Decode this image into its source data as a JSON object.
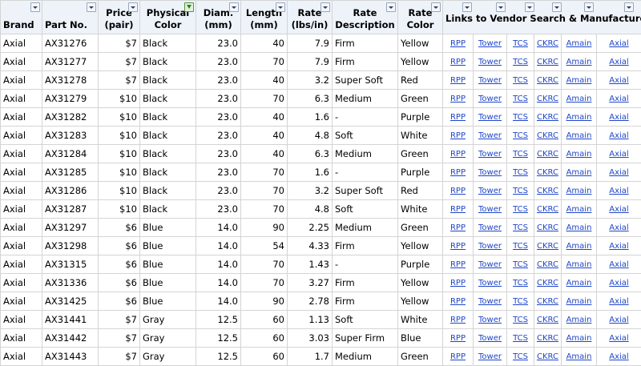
{
  "headers": {
    "brand": "Brand",
    "part": "Part No.",
    "price_line1": "Price",
    "price_line2": "(pair)",
    "color_line1": "Physical",
    "color_line2": "Color",
    "diam_line1": "Diam.",
    "diam_line2": "(mm)",
    "length_line1": "Length",
    "length_line2": "(mm)",
    "rate_line1": "Rate",
    "rate_line2": "(lbs/in)",
    "ratedesc_line1": "Rate",
    "ratedesc_line2": "Description",
    "ratecolor_line1": "Rate",
    "ratecolor_line2": "Color",
    "links": "Links to Vendor Search & Manufacturer"
  },
  "filters": {
    "active_icon": "filter-funnel-icon",
    "inactive_icon": "dropdown-arrow-icon"
  },
  "link_labels": [
    "RPP",
    "Tower",
    "TCS",
    "CKRC",
    "Amain",
    "Axial"
  ],
  "rows": [
    {
      "brand": "Axial",
      "part": "AX31276",
      "price": "$7",
      "color": "Black",
      "diam": "23.0",
      "length": "40",
      "rate": "7.9",
      "desc": "Firm",
      "rcolor": "Yellow"
    },
    {
      "brand": "Axial",
      "part": "AX31277",
      "price": "$7",
      "color": "Black",
      "diam": "23.0",
      "length": "70",
      "rate": "7.9",
      "desc": "Firm",
      "rcolor": "Yellow"
    },
    {
      "brand": "Axial",
      "part": "AX31278",
      "price": "$7",
      "color": "Black",
      "diam": "23.0",
      "length": "40",
      "rate": "3.2",
      "desc": "Super Soft",
      "rcolor": "Red"
    },
    {
      "brand": "Axial",
      "part": "AX31279",
      "price": "$10",
      "color": "Black",
      "diam": "23.0",
      "length": "70",
      "rate": "6.3",
      "desc": "Medium",
      "rcolor": "Green"
    },
    {
      "brand": "Axial",
      "part": "AX31282",
      "price": "$10",
      "color": "Black",
      "diam": "23.0",
      "length": "40",
      "rate": "1.6",
      "desc": "-",
      "rcolor": "Purple"
    },
    {
      "brand": "Axial",
      "part": "AX31283",
      "price": "$10",
      "color": "Black",
      "diam": "23.0",
      "length": "40",
      "rate": "4.8",
      "desc": "Soft",
      "rcolor": "White"
    },
    {
      "brand": "Axial",
      "part": "AX31284",
      "price": "$10",
      "color": "Black",
      "diam": "23.0",
      "length": "40",
      "rate": "6.3",
      "desc": "Medium",
      "rcolor": "Green"
    },
    {
      "brand": "Axial",
      "part": "AX31285",
      "price": "$10",
      "color": "Black",
      "diam": "23.0",
      "length": "70",
      "rate": "1.6",
      "desc": "-",
      "rcolor": "Purple"
    },
    {
      "brand": "Axial",
      "part": "AX31286",
      "price": "$10",
      "color": "Black",
      "diam": "23.0",
      "length": "70",
      "rate": "3.2",
      "desc": "Super Soft",
      "rcolor": "Red"
    },
    {
      "brand": "Axial",
      "part": "AX31287",
      "price": "$10",
      "color": "Black",
      "diam": "23.0",
      "length": "70",
      "rate": "4.8",
      "desc": "Soft",
      "rcolor": "White"
    },
    {
      "brand": "Axial",
      "part": "AX31297",
      "price": "$6",
      "color": "Blue",
      "diam": "14.0",
      "length": "90",
      "rate": "2.25",
      "desc": "Medium",
      "rcolor": "Green"
    },
    {
      "brand": "Axial",
      "part": "AX31298",
      "price": "$6",
      "color": "Blue",
      "diam": "14.0",
      "length": "54",
      "rate": "4.33",
      "desc": "Firm",
      "rcolor": "Yellow"
    },
    {
      "brand": "Axial",
      "part": "AX31315",
      "price": "$6",
      "color": "Blue",
      "diam": "14.0",
      "length": "70",
      "rate": "1.43",
      "desc": "-",
      "rcolor": "Purple"
    },
    {
      "brand": "Axial",
      "part": "AX31336",
      "price": "$6",
      "color": "Blue",
      "diam": "14.0",
      "length": "70",
      "rate": "3.27",
      "desc": "Firm",
      "rcolor": "Yellow"
    },
    {
      "brand": "Axial",
      "part": "AX31425",
      "price": "$6",
      "color": "Blue",
      "diam": "14.0",
      "length": "90",
      "rate": "2.78",
      "desc": "Firm",
      "rcolor": "Yellow"
    },
    {
      "brand": "Axial",
      "part": "AX31441",
      "price": "$7",
      "color": "Gray",
      "diam": "12.5",
      "length": "60",
      "rate": "1.13",
      "desc": "Soft",
      "rcolor": "White"
    },
    {
      "brand": "Axial",
      "part": "AX31442",
      "price": "$7",
      "color": "Gray",
      "diam": "12.5",
      "length": "60",
      "rate": "3.03",
      "desc": "Super Firm",
      "rcolor": "Blue"
    },
    {
      "brand": "Axial",
      "part": "AX31443",
      "price": "$7",
      "color": "Gray",
      "diam": "12.5",
      "length": "60",
      "rate": "1.7",
      "desc": "Medium",
      "rcolor": "Green"
    }
  ]
}
